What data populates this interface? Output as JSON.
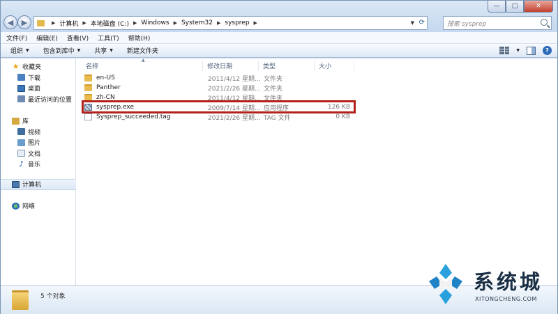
{
  "window": {
    "minimize_label": "—",
    "maximize_label": "□",
    "close_label": "✕"
  },
  "address": {
    "crumbs": [
      "计算机",
      "本地磁盘 (C:)",
      "Windows",
      "System32",
      "sysprep"
    ],
    "search_placeholder": "搜索 sysprep"
  },
  "menu": [
    "文件(F)",
    "编辑(E)",
    "查看(V)",
    "工具(T)",
    "帮助(H)"
  ],
  "toolbar": {
    "organize": "组织",
    "include_library": "包含到库中",
    "share": "共享",
    "new_folder": "新建文件夹"
  },
  "sidebar": {
    "favorites": "收藏夹",
    "downloads": "下载",
    "desktop": "桌面",
    "recent": "最近访问的位置",
    "libraries": "库",
    "videos": "视频",
    "pictures": "图片",
    "documents": "文档",
    "music": "音乐",
    "computer": "计算机",
    "network": "网络"
  },
  "columns": {
    "name": "名称",
    "date": "修改日期",
    "type": "类型",
    "size": "大小"
  },
  "files": [
    {
      "name": "en-US",
      "date": "2011/4/12 星期...",
      "type": "文件夹",
      "size": "",
      "icon": "folder-icon"
    },
    {
      "name": "Panther",
      "date": "2021/2/26 星期...",
      "type": "文件夹",
      "size": "",
      "icon": "folder-icon"
    },
    {
      "name": "zh-CN",
      "date": "2011/4/12 星期...",
      "type": "文件夹",
      "size": "",
      "icon": "folder-icon"
    },
    {
      "name": "sysprep.exe",
      "date": "2009/7/14 星期...",
      "type": "应用程序",
      "size": "126 KB",
      "icon": "exe-icon"
    },
    {
      "name": "Sysprep_succeeded.tag",
      "date": "2021/2/26 星期...",
      "type": "TAG 文件",
      "size": "0 KB",
      "icon": "file-icon"
    }
  ],
  "status": {
    "count": "5 个对象"
  },
  "watermark": {
    "title": "系统城",
    "url": "XITONGCHENG.COM"
  },
  "colors": {
    "highlight": "#b3211b",
    "accent": "#2a7fc4"
  }
}
